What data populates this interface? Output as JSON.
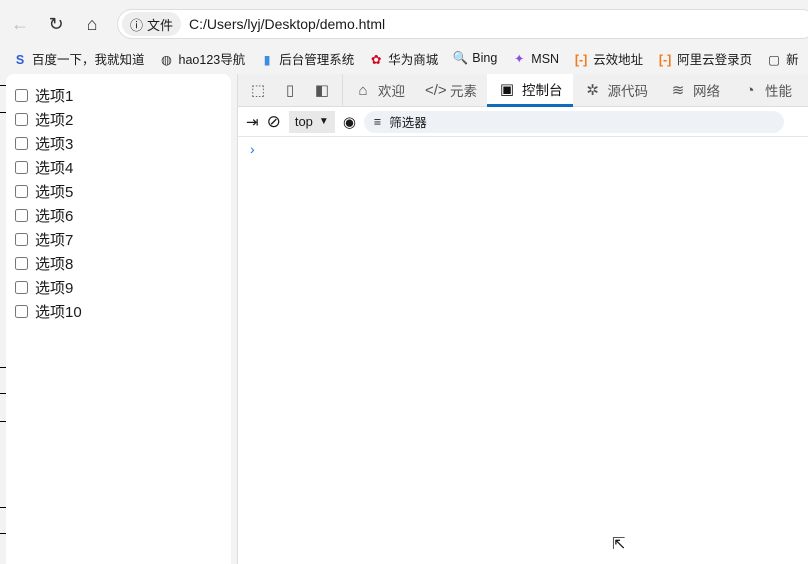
{
  "browser": {
    "url_chip": "文件",
    "url": "C:/Users/lyj/Desktop/demo.html"
  },
  "bookmarks": [
    {
      "icon": "S",
      "label": "百度一下，我就知道",
      "color": "#2b5ed8"
    },
    {
      "icon": "◍",
      "label": "hao123导航",
      "color": "#333"
    },
    {
      "icon": "▮",
      "label": "后台管理系统",
      "color": "#3a8de0"
    },
    {
      "icon": "✿",
      "label": "华为商城",
      "color": "#d0021b"
    },
    {
      "icon": "🔍",
      "label": "Bing",
      "color": "#1a73e8"
    },
    {
      "icon": "✦",
      "label": "MSN",
      "color": "#8a4fe0"
    },
    {
      "icon": "[-]",
      "label": "云效地址",
      "color": "#f07a20"
    },
    {
      "icon": "[-]",
      "label": "阿里云登录页",
      "color": "#f07a20"
    },
    {
      "icon": "▢",
      "label": "新",
      "color": "#333"
    }
  ],
  "options": [
    "选项1",
    "选项2",
    "选项3",
    "选项4",
    "选项5",
    "选项6",
    "选项7",
    "选项8",
    "选项9",
    "选项10"
  ],
  "devtools": {
    "tabs": [
      {
        "icon": "⌂",
        "label": "欢迎"
      },
      {
        "icon": "</>",
        "label": "元素"
      },
      {
        "icon": "▣",
        "label": "控制台"
      },
      {
        "icon": "✲",
        "label": "源代码"
      },
      {
        "icon": "≋",
        "label": "网络"
      },
      {
        "icon": "◔",
        "label": "性能"
      }
    ],
    "context": "top",
    "filter_placeholder": "筛选器",
    "prompt": "›"
  }
}
